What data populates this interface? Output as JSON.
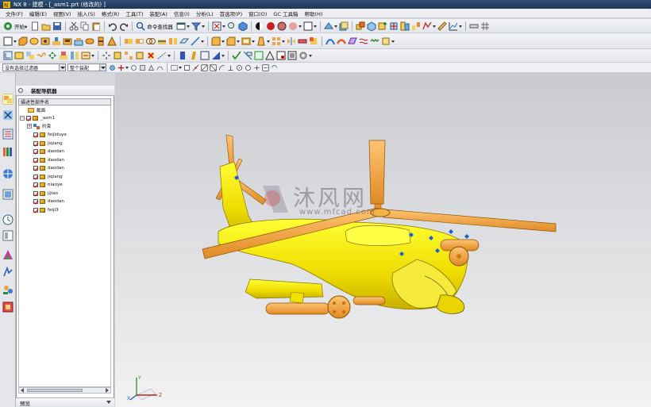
{
  "window": {
    "title": "NX 8 - 建模 - [_asm1.prt  (修改的) ]"
  },
  "menu": {
    "items": [
      "文件(F)",
      "编辑(E)",
      "视图(V)",
      "插入(S)",
      "格式(R)",
      "工具(T)",
      "装配(A)",
      "信息(I)",
      "分析(L)",
      "首选项(P)",
      "窗口(O)",
      "GC 工具箱",
      "帮助(H)"
    ]
  },
  "toolbar": {
    "start_label": "开始▾",
    "command_finder_label": "命令查找器",
    "selection_filter": "没有选择过滤器",
    "scope": "整个装配"
  },
  "navigator": {
    "title": "装配导航器",
    "column_header": "描述性部件名",
    "sections_label": "截面",
    "root": "_asm1",
    "constraints_label": "约束",
    "parts": [
      "feijiduye",
      "jiqiang",
      "daodan",
      "daodan",
      "daodan",
      "jiqiang",
      "niaoye",
      "jijiao",
      "daodan",
      "feiji3"
    ],
    "preview_label": "预览"
  },
  "watermark": {
    "text": "沐风网",
    "url": "www.mfcad.com"
  },
  "colors": {
    "part_yellow": "#ffee00",
    "part_orange": "#f2a33a",
    "titlebar": "#1d3656"
  }
}
